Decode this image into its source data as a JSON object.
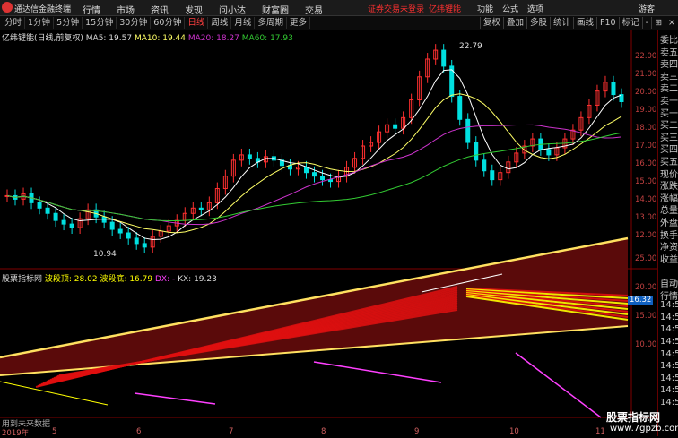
{
  "topbar": {
    "app_name": "通达信金融终端",
    "menu": [
      "行情",
      "市场",
      "资讯",
      "发现",
      "问小达",
      "财富圈",
      "交易"
    ],
    "status": "证券交易未登录",
    "user": "亿纬锂能",
    "right_menu": [
      "功能",
      "公式",
      "选项"
    ],
    "guest": "游客"
  },
  "toolbar": {
    "periods": [
      "分时",
      "1分钟",
      "5分钟",
      "15分钟",
      "30分钟",
      "60分钟",
      "日线",
      "周线",
      "月线",
      "多周期",
      "更多"
    ],
    "active": "日线",
    "buttons": [
      "复权",
      "叠加",
      "多股",
      "统计",
      "画线",
      "F10",
      "标记",
      "-",
      "⊞",
      "×"
    ]
  },
  "main_chart": {
    "title": "亿纬锂能(日线,前复权)",
    "ma5_label": "MA5: 19.57",
    "ma10_label": "MA10: 19.44",
    "ma20_label": "MA20: 18.27",
    "ma60_label": "MA60: 17.93",
    "high_label": "22.79",
    "low_label": "10.94",
    "y_ticks": [
      "22.00",
      "21.00",
      "20.00",
      "19.00",
      "18.00",
      "17.00",
      "16.00",
      "15.00",
      "14.00",
      "13.00",
      "12.00"
    ],
    "colors": {
      "up": "#ff3030",
      "down": "#00e0e0",
      "ma5": "#ffffff",
      "ma10": "#ffff66",
      "ma20": "#cc33cc",
      "ma60": "#33cc33"
    }
  },
  "indicator": {
    "title": "股票指标网",
    "wave_top": "波段顶: 28.02",
    "wave_bottom": "波段底: 16.79",
    "dx": "DX: -",
    "kx": "KX: 19.23",
    "y_ticks": [
      "25.00",
      "20.00",
      "15.00",
      "10.00"
    ],
    "price_tag": "16.32"
  },
  "right_panel": {
    "items": [
      "委比",
      "卖五",
      "卖四",
      "卖三",
      "卖二",
      "卖一",
      "买一",
      "买二",
      "买三",
      "买四",
      "买五",
      "现价",
      "涨跌",
      "涨幅",
      "总量",
      "外盘",
      "换手",
      "净资",
      "收益",
      "",
      "自动",
      "行情",
      "14:5",
      "14:5",
      "14:5",
      "14:5",
      "14:5",
      "14:5",
      "14:5",
      "14:5",
      "14:5"
    ]
  },
  "footer": {
    "left_text": "用到未来数据",
    "x_labels": [
      "2019年",
      "5",
      "6",
      "7",
      "8",
      "9",
      "10",
      "11"
    ]
  },
  "watermark": {
    "line1": "股票指标网",
    "line2": "www.7gpzb.com"
  }
}
